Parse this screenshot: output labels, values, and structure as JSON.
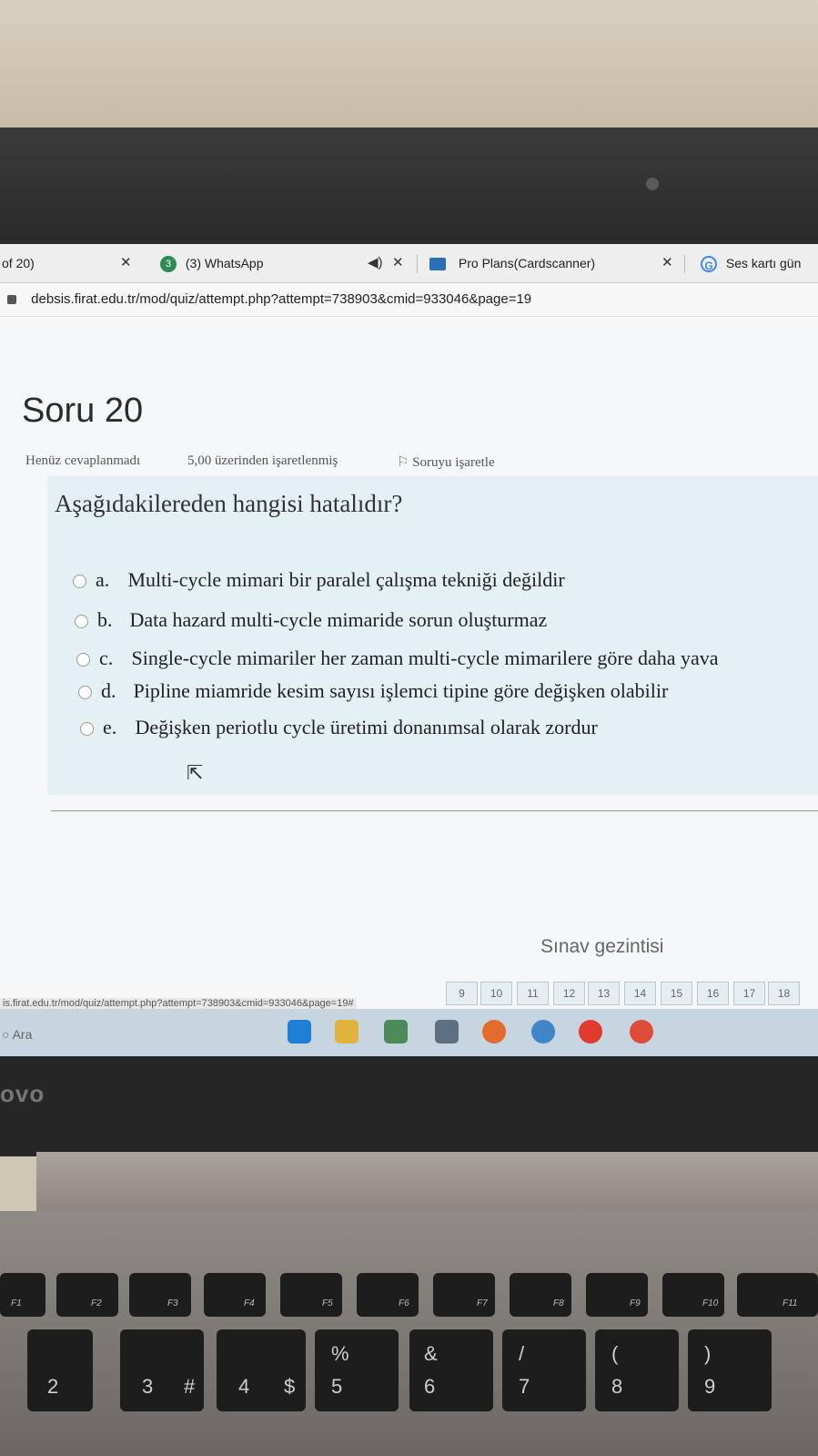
{
  "browser": {
    "tabs": [
      {
        "label": "of 20)"
      },
      {
        "label": "(3) WhatsApp",
        "badge": "3"
      },
      {
        "label": "Pro Plans(Cardscanner)"
      },
      {
        "label": "Ses kartı gün"
      }
    ],
    "address": "debsis.firat.edu.tr/mod/quiz/attempt.php?attempt=738903&cmid=933046&page=19"
  },
  "question": {
    "title": "Soru 20",
    "status": "Henüz cevaplanmadı",
    "grade": "5,00 üzerinden işaretlenmiş",
    "flag": "Soruyu işaretle",
    "text": "Aşağıdakilereden hangisi hatalıdır?",
    "options": [
      {
        "letter": "a.",
        "text": "Multi-cycle mimari bir paralel çalışma tekniği değildir"
      },
      {
        "letter": "b.",
        "text": "Data hazard multi-cycle mimaride sorun oluşturmaz"
      },
      {
        "letter": "c.",
        "text": "Single-cycle mimariler her zaman multi-cycle mimarilere göre daha yava"
      },
      {
        "letter": "d.",
        "text": "Pipline miamride kesim sayısı işlemci tipine göre değişken olabilir"
      },
      {
        "letter": "e.",
        "text": "Değişken periotlu cycle üretimi donanımsal olarak zordur"
      }
    ]
  },
  "navigation": {
    "title": "Sınav gezintisi",
    "buttons": [
      "9",
      "10",
      "11",
      "12",
      "13",
      "14",
      "15",
      "16",
      "17",
      "18"
    ]
  },
  "status_url": "is.firat.edu.tr/mod/quiz/attempt.php?attempt=738903&cmid=933046&page=19#",
  "taskbar": {
    "search": "Ara"
  },
  "laptop": {
    "brand": "ovo",
    "fkeys": [
      "F1",
      "F2",
      "F3",
      "F4",
      "F5",
      "F6",
      "F7",
      "F8",
      "F9",
      "F10",
      "F11"
    ],
    "numkeys": [
      "2",
      "3",
      "4",
      "5",
      "6",
      "7",
      "8",
      "9"
    ],
    "symbols": [
      "#",
      "$",
      "%",
      "&",
      "/",
      "(",
      ")"
    ]
  }
}
